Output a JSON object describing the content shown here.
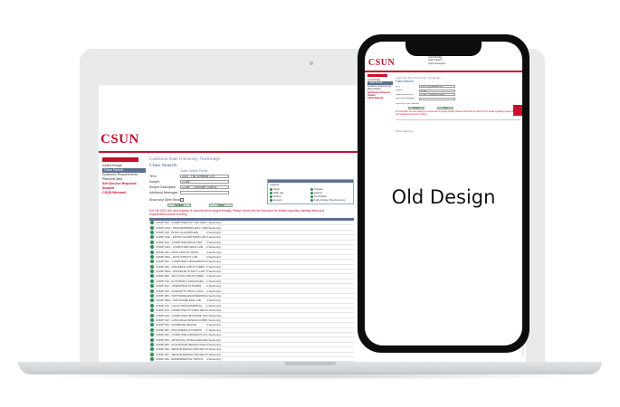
{
  "caption": "Old Design",
  "brand": "CSUN",
  "colors": {
    "brand_red": "#c8102e",
    "heading_blue": "#6b7fa3",
    "bar_slate": "#5c6f8f",
    "status_green": "#2e8b57"
  },
  "site": {
    "university": "California State University, Northridge",
    "page_title": "Class Search",
    "sidebar": [
      {
        "label": "myNorthridge",
        "style": "normal"
      },
      {
        "label": "Class Search",
        "style": "active"
      },
      {
        "label": "Academic Requirements",
        "style": "normal"
      },
      {
        "label": "PlannedClass",
        "style": "normal"
      },
      {
        "label": "Self-Service Requests",
        "style": "red"
      },
      {
        "label": "Student",
        "style": "red"
      },
      {
        "label": "CSUN Webmail",
        "style": "red"
      }
    ],
    "form": {
      "heading": "Class Search Fields",
      "fields": [
        {
          "label": "Term",
          "value": "2020 - Fall Semester (Dr)"
        },
        {
          "label": "Subject",
          "value": "COMP"
        },
        {
          "label": "Subject Description",
          "value": "COMP - Computer Science"
        },
        {
          "label": "Additional Messages",
          "value": ""
        }
      ],
      "show_open_label": "Show only Open Sections",
      "search_button": "Search",
      "clear_button": "Clear"
    },
    "legend_title": "Legend",
    "legend": [
      "Open",
      "Closed",
      "Wait List",
      "Hybrid",
      "Online",
      "Cancelled",
      "Honors",
      "Fully Online Synchronous"
    ],
    "warning": "For Fall 2020, the vast majority of courses will be taught virtually. Please check with the instructor for details regarding meeting times and requirements before enrolling.",
    "courses": [
      {
        "name": "COMP 100 - COMPUTERS MY DIG LIFE",
        "sec": "7 Section(s)"
      },
      {
        "name": "COMP 100L - PROGRAMMING ENV LAB",
        "sec": "4 Section(s)"
      },
      {
        "name": "COMP 110 - INTRO ALGORITHMS",
        "sec": "3 Section(s)"
      },
      {
        "name": "COMP 110L - INTRO ALGORITHMS LAB",
        "sec": "3 Section(s)"
      },
      {
        "name": "COMP 122 - COMPUTER ARCH ASM",
        "sec": "2 Section(s)"
      },
      {
        "name": "COMP 122L - COMPUTER ARCH LAB",
        "sec": "2 Section(s)"
      },
      {
        "name": "COMP 182 - DATA STRUCT PROG",
        "sec": "4 Section(s)"
      },
      {
        "name": "COMP 182L - DATA STRUCT LAB",
        "sec": "4 Section(s)"
      },
      {
        "name": "COMP 222 - COMPUTER ORGANIZATION",
        "sec": "3 Section(s)"
      },
      {
        "name": "COMP 256 - DISCRETE STRUCTURES",
        "sec": "5 Section(s)"
      },
      {
        "name": "COMP 256L - DISCRETE STRUCT LAB",
        "sec": "5 Section(s)"
      },
      {
        "name": "COMP 282 - ADV DATA STRUCTURES",
        "sec": "3 Section(s)"
      },
      {
        "name": "COMP 310 - AUTOMATA LANGUAGES",
        "sec": "2 Section(s)"
      },
      {
        "name": "COMP 322 - OPERATING SYSTEMS",
        "sec": "3 Section(s)"
      },
      {
        "name": "COMP 333 - CONCEPTS PROG LANG",
        "sec": "2 Section(s)"
      },
      {
        "name": "COMP 380 - SOFTWARE ENGINEERING",
        "sec": "4 Section(s)"
      },
      {
        "name": "COMP 380L - SOFTWARE ENG LAB",
        "sec": "4 Section(s)"
      },
      {
        "name": "COMP 410 - LOGIC PROGRAMMING",
        "sec": "1 Section(s)"
      },
      {
        "name": "COMP 424 - COMPUTER SYSTEM SECURITY",
        "sec": "2 Section(s)"
      },
      {
        "name": "COMP 429 - COMPUTER NETWORK SOFT",
        "sec": "2 Section(s)"
      },
      {
        "name": "COMP 430 - LANGUAGE DESIGN COMP",
        "sec": "1 Section(s)"
      },
      {
        "name": "COMP 440 - DATABASE DESIGN",
        "sec": "3 Section(s)"
      },
      {
        "name": "COMP 450 - MULTIMEDIA SYSTEMS",
        "sec": "1 Section(s)"
      },
      {
        "name": "COMP 465 - COMPUTER GRAPHICS SYS",
        "sec": "1 Section(s)"
      },
      {
        "name": "COMP 469 - ARTIFICIAL INTELLIGENCE",
        "sec": "2 Section(s)"
      },
      {
        "name": "COMP 482 - ALGORITHM DESIGN ANALYS",
        "sec": "3 Section(s)"
      },
      {
        "name": "COMP 490 - SENIOR DESIGN PROJECT",
        "sec": "3 Section(s)"
      },
      {
        "name": "COMP 491 - SENIOR DESIGN PROJECT",
        "sec": "3 Section(s)"
      },
      {
        "name": "COMP 496 - EXPERIMENTAL TOPICS",
        "sec": "4 Section(s)"
      }
    ],
    "footer_link": "Privacy Statement"
  },
  "phone": {
    "top_links": [
      "myNorthridge",
      "Class Search",
      "Quick Navigation"
    ]
  }
}
